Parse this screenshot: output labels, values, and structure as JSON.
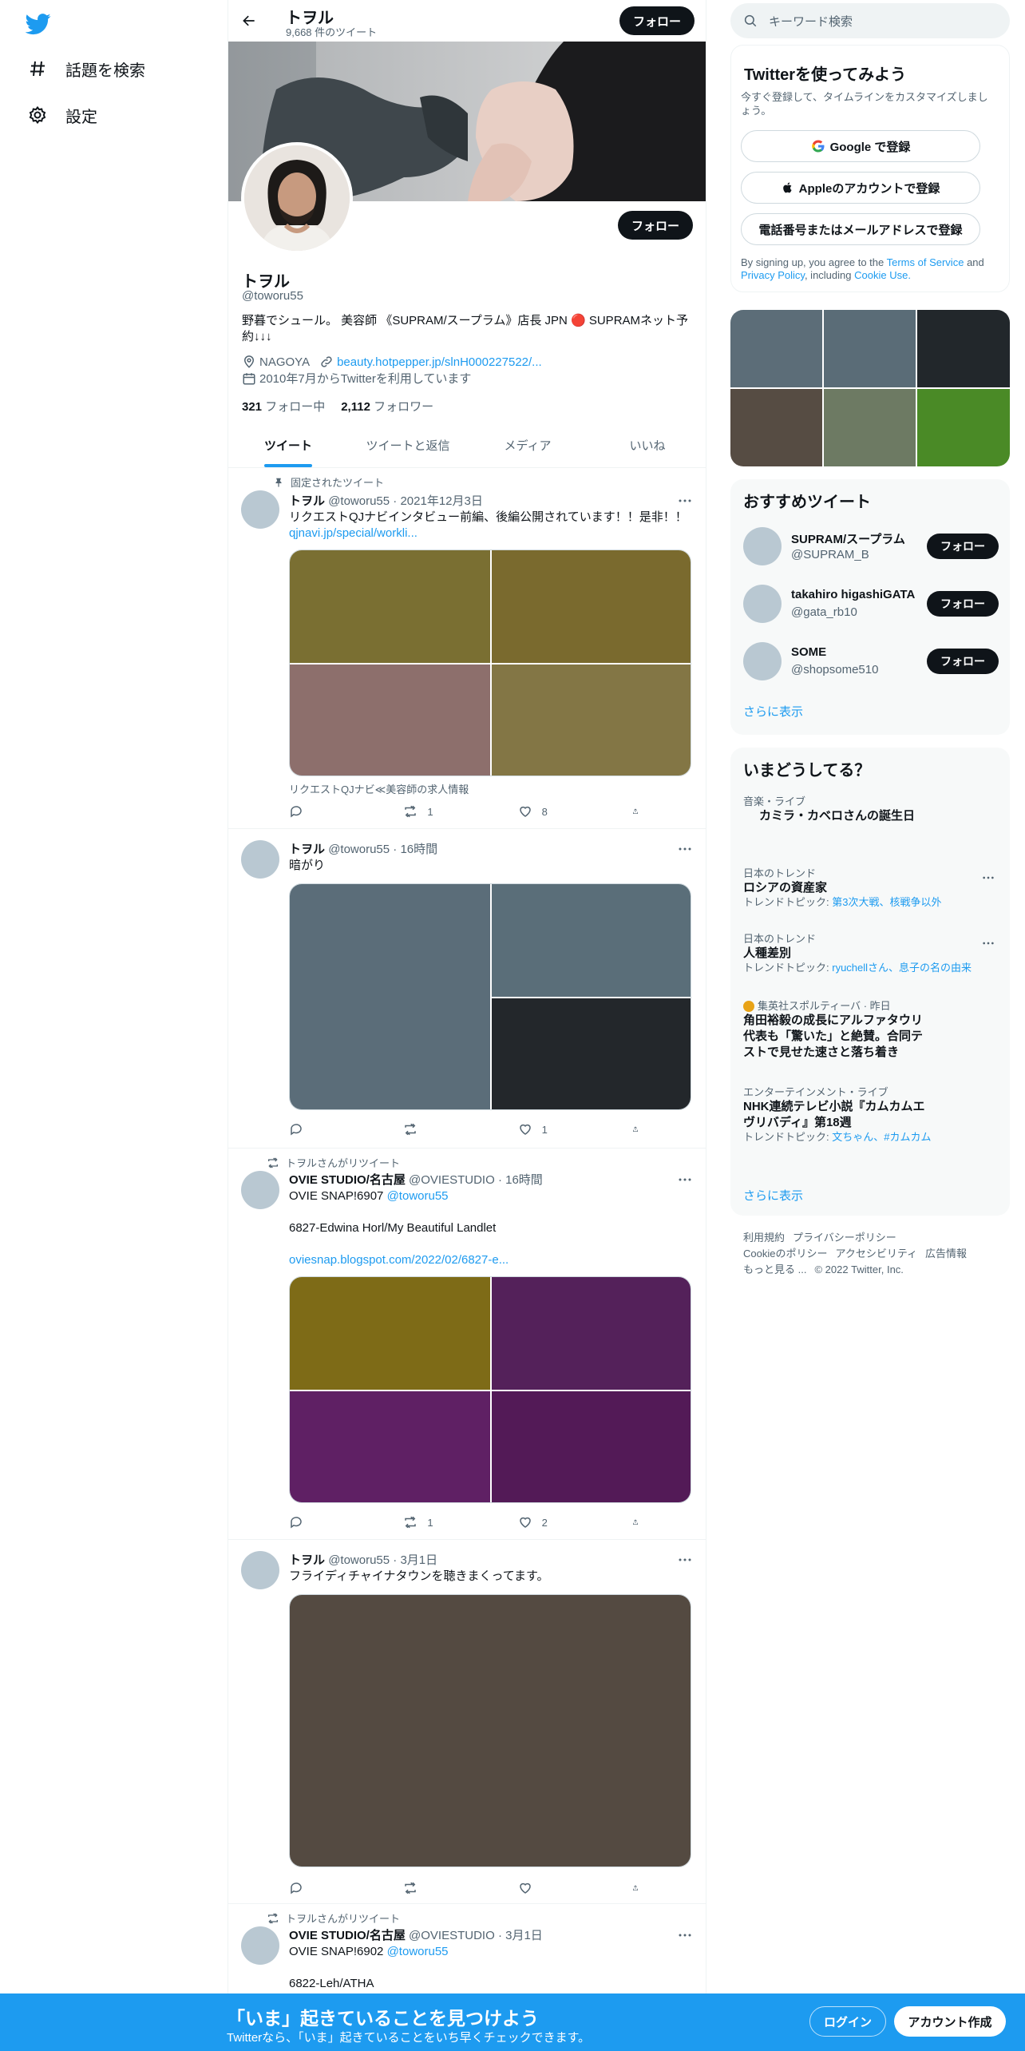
{
  "nav": {
    "items": [
      {
        "label": "話題を検索",
        "icon": "hashtag-icon"
      },
      {
        "label": "設定",
        "icon": "gear-icon"
      }
    ]
  },
  "header": {
    "name": "トヲル",
    "tweet_count": "9,668 件のツイート",
    "follow_label": "フォロー"
  },
  "profile": {
    "name": "トヲル",
    "handle": "@toworu55",
    "bio": "野暮でシュール。 美容師 《SUPRAM/スープラム》店長 JPN 🔴 SUPRAMネット予約↓↓↓",
    "location": "NAGOYA",
    "link": "beauty.hotpepper.jp/slnH000227522/...",
    "joined": "2010年7月からTwitterを利用しています",
    "following_count": "321",
    "following_label": "フォロー中",
    "followers_count": "2,112",
    "followers_label": "フォロワー",
    "follow_label": "フォロー"
  },
  "tabs": [
    "ツイート",
    "ツイートと返信",
    "メディア",
    "いいね"
  ],
  "tweets": [
    {
      "social": "固定されたツイート",
      "name": "トヲル",
      "handle": "@toworu55",
      "time": "2021年12月3日",
      "text": "リクエストQJナビインタビュー前編、後編公開されています！！是非！！",
      "link": "qjnavi.jp/special/workli...",
      "card_caption": "リクエストQJナビ≪美容師の求人情報",
      "replies": "",
      "retweets": "1",
      "likes": "8",
      "media_colors": [
        "#7a6f32",
        "#7a6a2e",
        "#8d6f6c",
        "#837645"
      ]
    },
    {
      "social": "",
      "name": "トヲル",
      "handle": "@toworu55",
      "time": "16時間",
      "text": "暗がり",
      "replies": "",
      "retweets": "",
      "likes": "1",
      "media_colors": [
        "#5b6d79",
        "#5a6e79",
        "#23272b"
      ]
    },
    {
      "social": "トヲルさんがリツイート",
      "name": "OVIE STUDIO/名古屋",
      "handle": "@OVIESTUDIO",
      "time": "16時間",
      "text_line1": "OVIE SNAP!6907",
      "mention": "@toworu55",
      "text_line2": "6827-Edwina Horl/My Beautiful Landlet",
      "link": "oviesnap.blogspot.com/2022/02/6827-e...",
      "replies": "",
      "retweets": "1",
      "likes": "2",
      "media_colors": [
        "#7e6b17",
        "#54215a",
        "#5f2064",
        "#531a57"
      ]
    },
    {
      "social": "",
      "name": "トヲル",
      "handle": "@toworu55",
      "time": "3月1日",
      "text": "フライディチャイナタウンを聴きまくってます。",
      "replies": "",
      "retweets": "",
      "likes": "",
      "media_colors": [
        "#544a41"
      ]
    },
    {
      "social": "トヲルさんがリツイート",
      "name": "OVIE STUDIO/名古屋",
      "handle": "@OVIESTUDIO",
      "time": "3月1日",
      "text_line1": "OVIE SNAP!6902",
      "mention": "@toworu55",
      "text_line2": "6822-Leh/ATHA"
    }
  ],
  "search": {
    "placeholder": "キーワード検索"
  },
  "signup": {
    "title": "Twitterを使ってみよう",
    "subtitle": "今すぐ登録して、タイムラインをカスタマイズしましょう。",
    "google": "Google で登録",
    "apple": "Appleのアカウントで登録",
    "phone": "電話番号またはメールアドレスで登録",
    "legal_pre": "By signing up, you agree to the",
    "terms": "Terms of Service",
    "and": "and",
    "privacy": "Privacy Policy",
    "including": ", including",
    "cookie": "Cookie Use."
  },
  "photo_grid_colors": [
    "#5c6d78",
    "#5a6c77",
    "#22272b",
    "#564c43",
    "#6d7a63",
    "#4a8a26"
  ],
  "who_to_follow": {
    "title": "おすすめツイート",
    "users": [
      {
        "name": "SUPRAM/スープラム",
        "handle": "@SUPRAM_B",
        "button": "フォロー"
      },
      {
        "name": "takahiro higashiGATA",
        "handle": "@gata_rb10",
        "button": "フォロー"
      },
      {
        "name": "SOME",
        "handle": "@shopsome510",
        "button": "フォロー"
      }
    ],
    "show_more": "さらに表示"
  },
  "trends": {
    "title": "いまどうしてる？",
    "items": [
      {
        "context": "音楽・ライブ",
        "title": "カミラ・カベロさんの誕生日"
      },
      {
        "context": "日本のトレンド",
        "title": "ロシアの資産家",
        "topics_label": "トレンドトピック:",
        "topics": "第3次大戦、核戦争以外"
      },
      {
        "context": "日本のトレンド",
        "title": "人種差別",
        "topics_label": "トレンドトピック:",
        "topics": "ryuchellさん、息子の名の由来"
      },
      {
        "context": "集英社スポルティーバ · 昨日",
        "title": "角田裕毅の成長にアルファタウリ代表も「驚いた」と絶賛。合同テストで見せた速さと落ち着き"
      },
      {
        "context": "エンターテインメント・ライブ",
        "title": "NHK連続テレビ小説『カムカムエヴリバディ』第18週",
        "topics_label": "トレンドトピック:",
        "topics": "文ちゃん、#カムカム"
      }
    ],
    "show_more": "さらに表示"
  },
  "footer": {
    "links": [
      "利用規約",
      "プライバシーポリシー",
      "Cookieのポリシー",
      "アクセシビリティ",
      "広告情報",
      "もっと見る ..."
    ],
    "copyright": "© 2022 Twitter, Inc."
  },
  "bottombar": {
    "title": "「いま」起きていることを見つけよう",
    "subtitle": "Twitterなら、「いま」起きていることをいち早くチェックできます。",
    "login": "ログイン",
    "signup": "アカウント作成"
  },
  "colors": {
    "accent": "#1d9bf0",
    "text": "#0f1419",
    "muted": "#536471",
    "dark_button": "#0f1419"
  }
}
